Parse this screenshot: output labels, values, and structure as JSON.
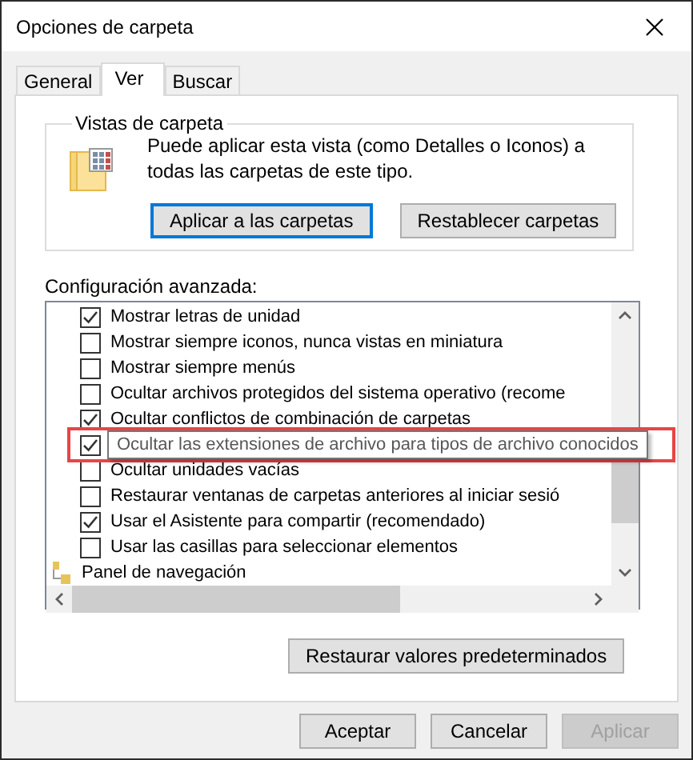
{
  "window": {
    "title": "Opciones de carpeta"
  },
  "tabs": [
    {
      "label": "General",
      "selected": false
    },
    {
      "label": "Ver",
      "selected": true
    },
    {
      "label": "Buscar",
      "selected": false
    }
  ],
  "folder_views": {
    "title": "Vistas de carpeta",
    "description": "Puede aplicar esta vista (como Detalles o Iconos) a todas las carpetas de este tipo.",
    "buttons": [
      {
        "label": "Aplicar a las carpetas",
        "focused": true
      },
      {
        "label": "Restablecer carpetas",
        "focused": false
      }
    ]
  },
  "advanced": {
    "label": "Configuración avanzada:",
    "items": [
      {
        "kind": "checkbox",
        "label": "Mostrar letras de unidad",
        "checked": true,
        "highlighted": false
      },
      {
        "kind": "checkbox",
        "label": "Mostrar siempre iconos, nunca vistas en miniatura",
        "checked": false,
        "highlighted": false
      },
      {
        "kind": "checkbox",
        "label": "Mostrar siempre menús",
        "checked": false,
        "highlighted": false
      },
      {
        "kind": "checkbox",
        "label": "Ocultar archivos protegidos del sistema operativo (recome",
        "checked": false,
        "highlighted": false
      },
      {
        "kind": "checkbox",
        "label": "Ocultar conflictos de combinación de carpetas",
        "checked": true,
        "highlighted": false
      },
      {
        "kind": "checkbox",
        "checked": true,
        "highlighted": true,
        "tooltip": "Ocultar las extensiones de archivo para tipos de archivo conocidos"
      },
      {
        "kind": "checkbox",
        "label": "Ocultar unidades vacías",
        "checked": false,
        "highlighted": false
      },
      {
        "kind": "checkbox",
        "label": "Restaurar ventanas de carpetas anteriores al iniciar sesió",
        "checked": false,
        "highlighted": false
      },
      {
        "kind": "checkbox",
        "label": "Usar el Asistente para compartir (recomendado)",
        "checked": true,
        "highlighted": false
      },
      {
        "kind": "checkbox",
        "label": "Usar las casillas para seleccionar elementos",
        "checked": false,
        "highlighted": false
      },
      {
        "kind": "folder",
        "label": "Panel de navegación",
        "highlighted": false
      }
    ]
  },
  "restore_button": "Restaurar valores predeterminados",
  "footer_buttons": [
    {
      "label": "Aceptar",
      "disabled": false
    },
    {
      "label": "Cancelar",
      "disabled": false
    },
    {
      "label": "Aplicar",
      "disabled": true
    }
  ]
}
